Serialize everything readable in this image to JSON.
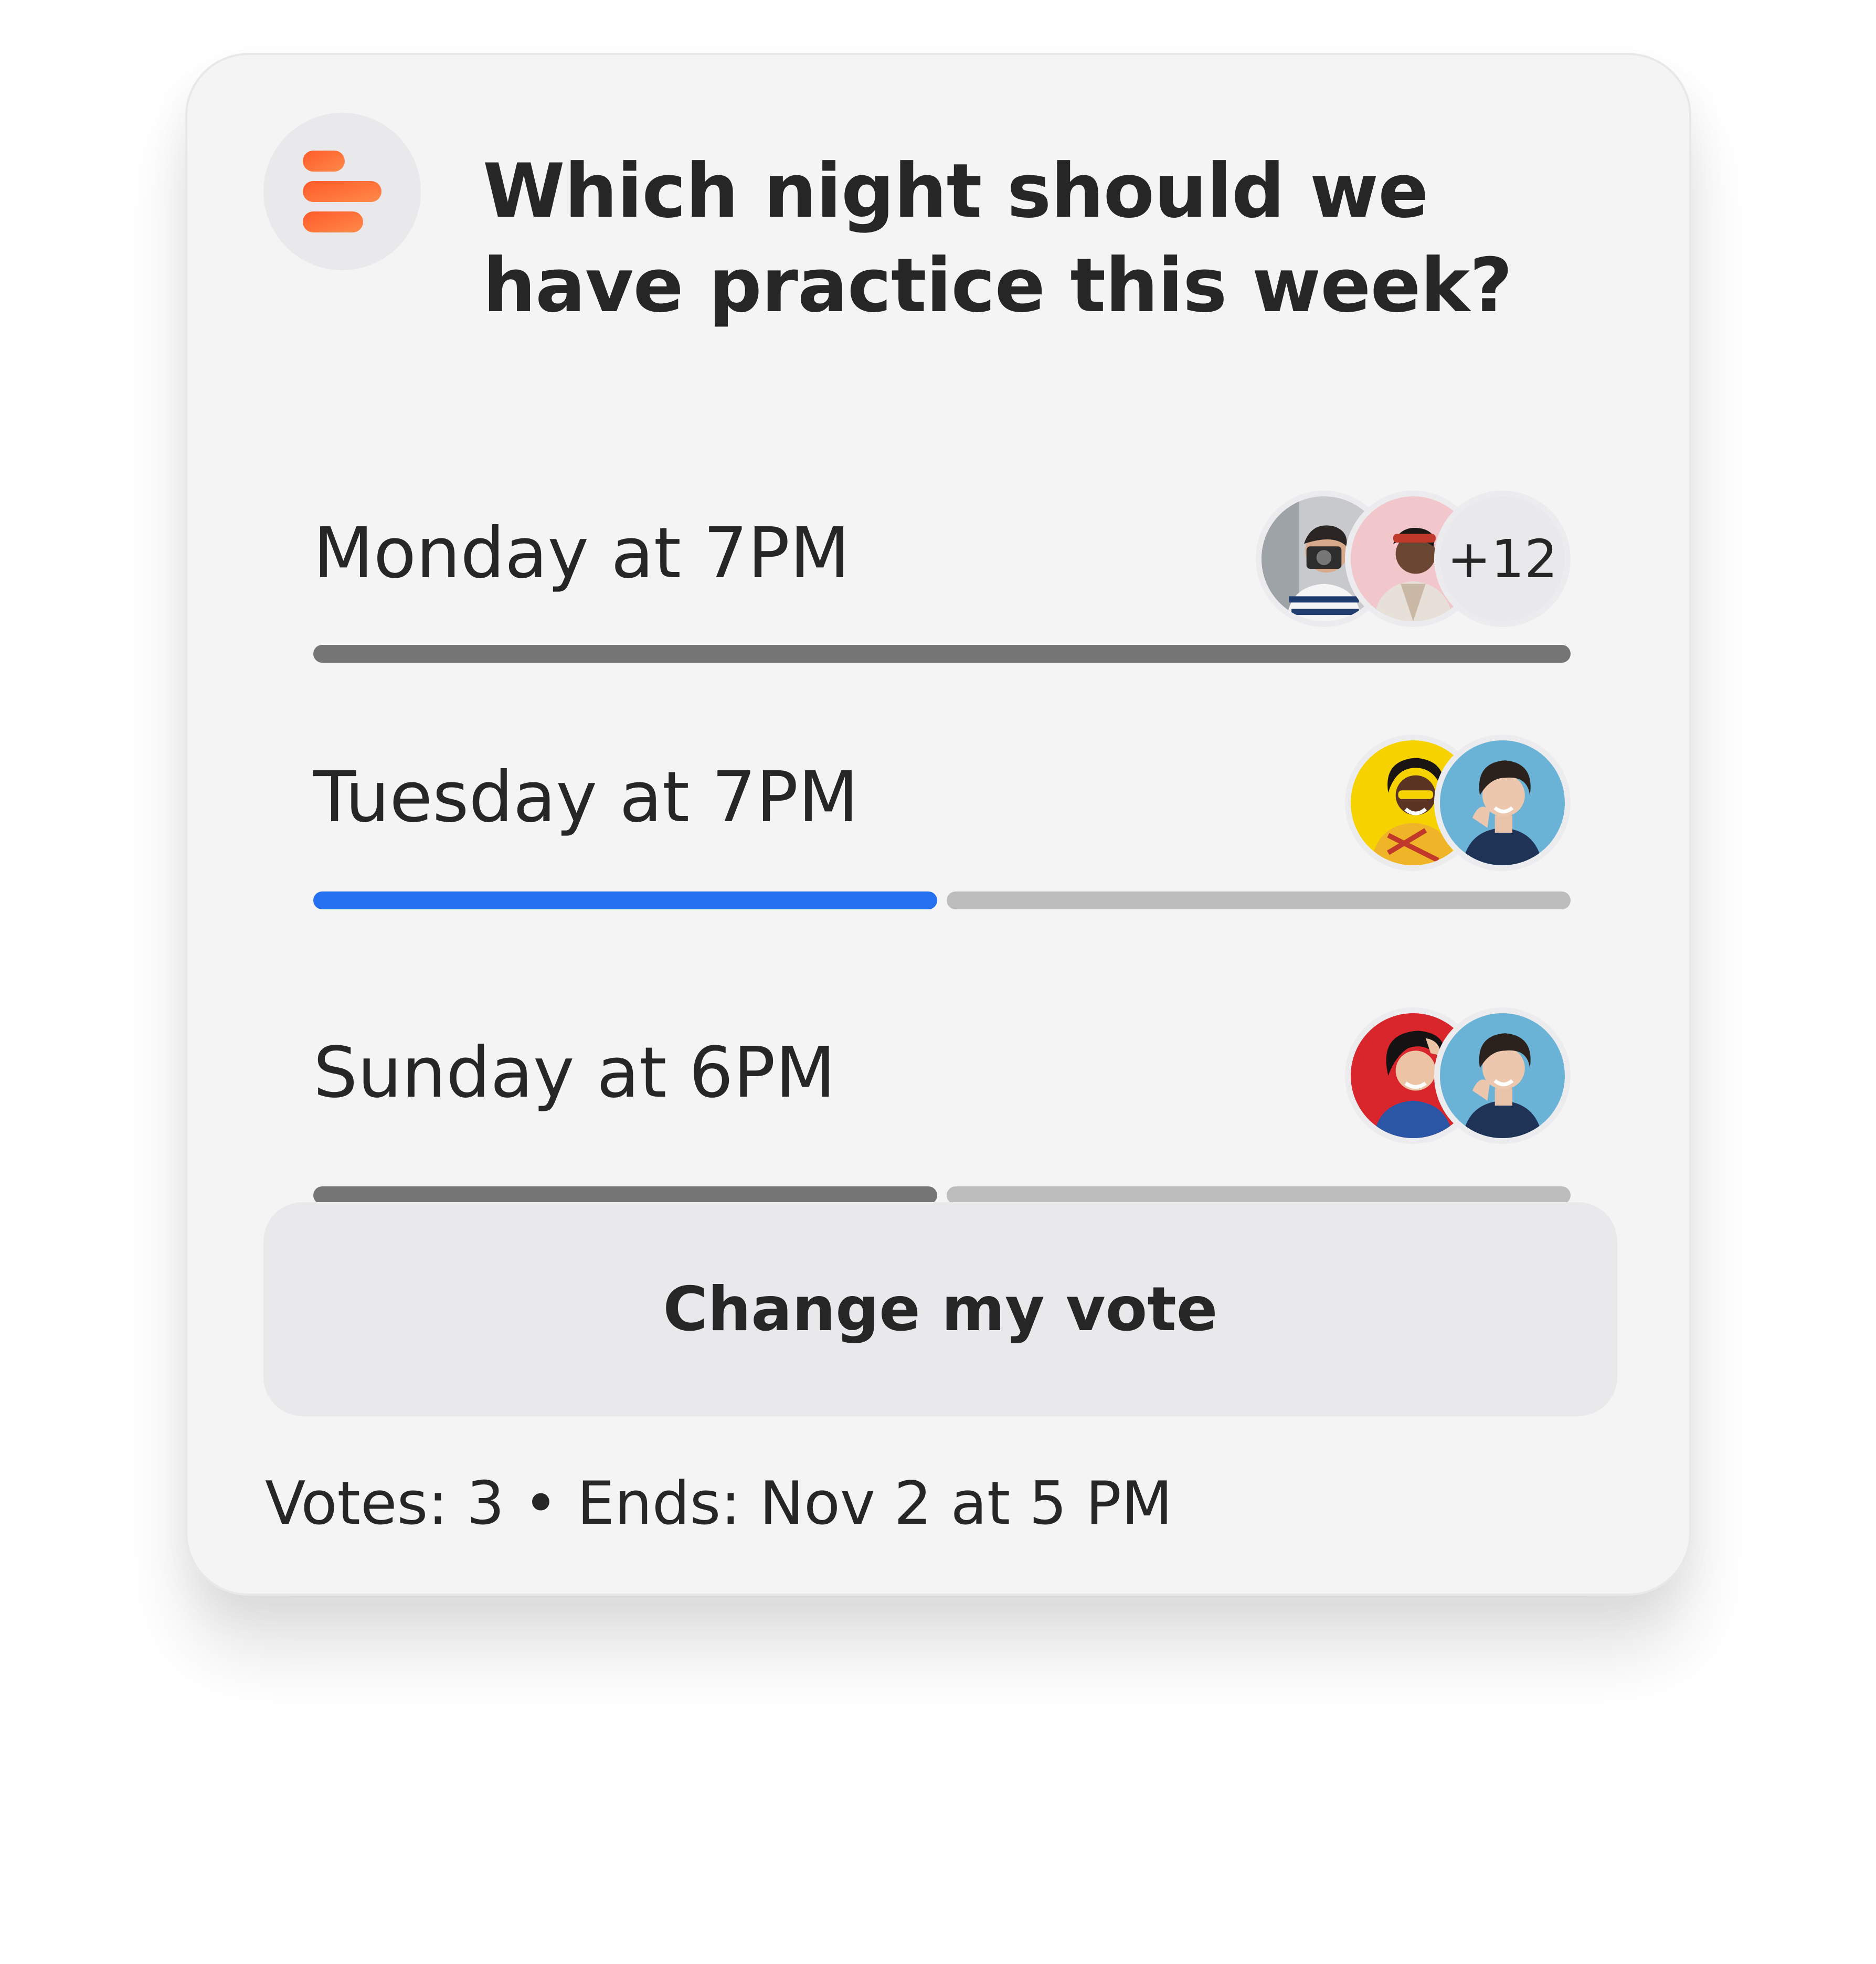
{
  "poll": {
    "question": "Which night should we have practice this week?",
    "icon": "poll-bars-icon",
    "accent_color": "#ff6b35",
    "options": [
      {
        "label": "Monday at 7PM",
        "fill_fraction": 1.0,
        "fill_color": "#757575",
        "selected": false,
        "voter_avatars": [
          "avatar-man-with-camera",
          "avatar-woman-pink-background"
        ],
        "more_voters": "+12"
      },
      {
        "label": "Tuesday at 7PM",
        "fill_fraction": 0.5,
        "fill_color": "#2570ef",
        "selected": true,
        "voter_avatars": [
          "avatar-woman-yellow-background",
          "avatar-woman-blue-background"
        ]
      },
      {
        "label": "Sunday at 6PM",
        "fill_fraction": 0.5,
        "fill_color": "#757575",
        "selected": false,
        "voter_avatars": [
          "avatar-woman-red-background",
          "avatar-woman-blue-background"
        ]
      }
    ],
    "change_vote_label": "Change my vote",
    "footer": "Votes: 3 • Ends: Nov 2 at 5 PM"
  }
}
